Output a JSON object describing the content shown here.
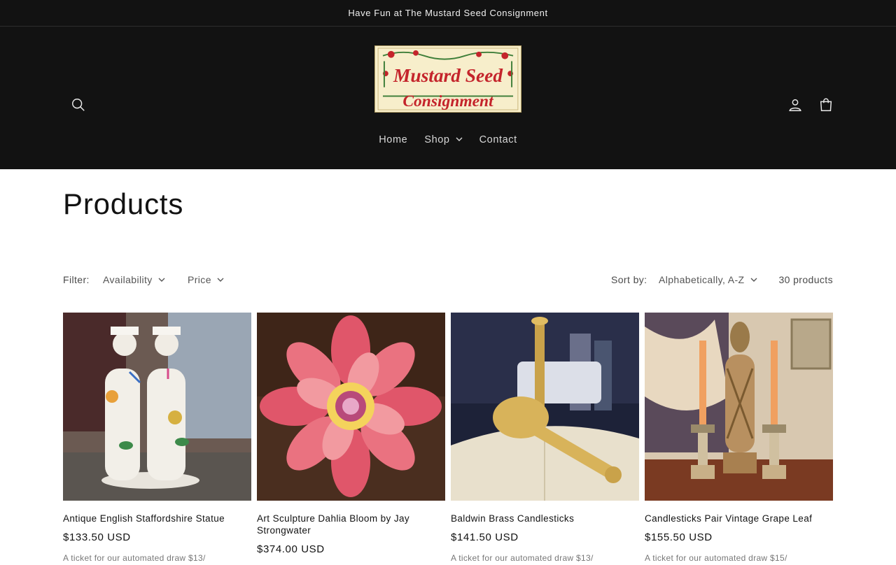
{
  "announcement": {
    "text": "Have Fun at The Mustard Seed Consignment"
  },
  "header": {
    "logo": {
      "line1": "Mustard Seed",
      "line2": "Consignment"
    },
    "icons": {
      "search": "search-icon",
      "account": "account-icon",
      "cart": "cart-icon"
    },
    "nav": [
      {
        "label": "Home"
      },
      {
        "label": "Shop",
        "has_dropdown": true
      },
      {
        "label": "Contact"
      }
    ]
  },
  "page": {
    "title": "Products"
  },
  "filters": {
    "filter_label": "Filter:",
    "availability": "Availability",
    "price": "Price",
    "sort_label": "Sort by:",
    "sort_value": "Alphabetically, A-Z",
    "count": "30 products"
  },
  "products": [
    {
      "title": "Antique English Staffordshire Statue",
      "price": "$133.50 USD",
      "desc": "A ticket for our automated draw $13/"
    },
    {
      "title": "Art Sculpture Dahlia Bloom by Jay Strongwater",
      "price": "$374.00 USD",
      "desc": ""
    },
    {
      "title": "Baldwin Brass Candlesticks",
      "price": "$141.50 USD",
      "desc": "A ticket for our automated draw $13/"
    },
    {
      "title": "Candlesticks Pair Vintage Grape Leaf",
      "price": "$155.50 USD",
      "desc": "A ticket for our automated draw $15/"
    }
  ],
  "colors": {
    "header_bg": "#121212",
    "text": "#121212",
    "muted": "#777777"
  }
}
